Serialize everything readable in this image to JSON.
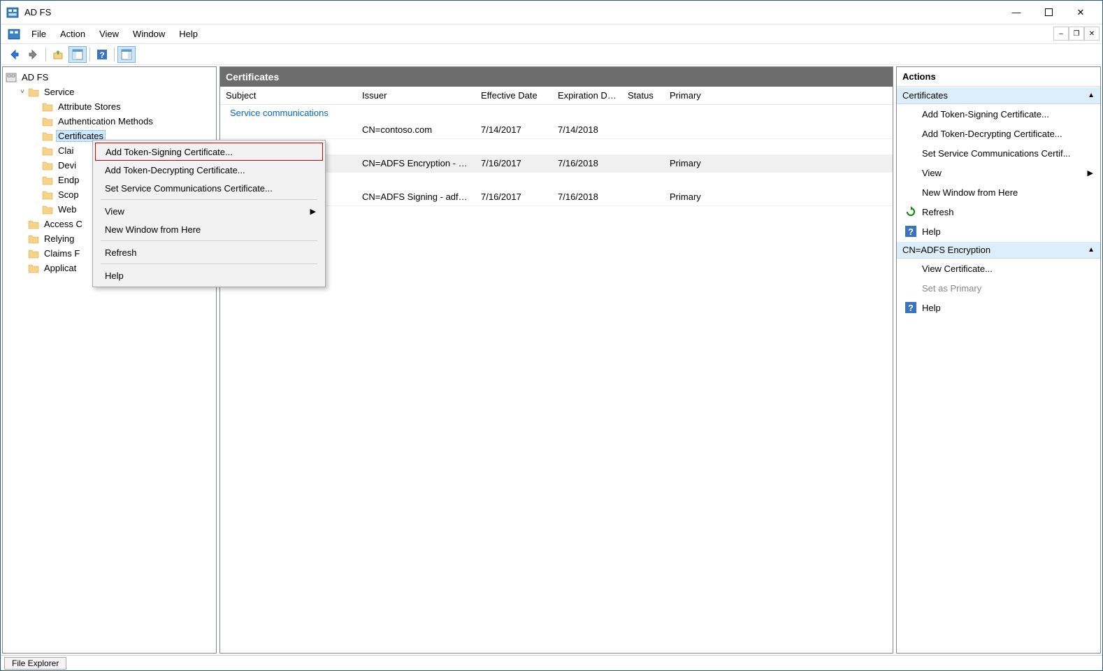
{
  "title": "AD FS",
  "menubar": [
    "File",
    "Action",
    "View",
    "Window",
    "Help"
  ],
  "tree": {
    "root": "AD FS",
    "nodes": [
      {
        "label": "Service",
        "indent": 1,
        "expandable": true,
        "expanded": true
      },
      {
        "label": "Attribute Stores",
        "indent": 2
      },
      {
        "label": "Authentication Methods",
        "indent": 2
      },
      {
        "label": "Certificates",
        "indent": 2,
        "selected": true
      },
      {
        "label": "Clai",
        "indent": 2
      },
      {
        "label": "Devi",
        "indent": 2
      },
      {
        "label": "Endp",
        "indent": 2
      },
      {
        "label": "Scop",
        "indent": 2
      },
      {
        "label": "Web",
        "indent": 2
      },
      {
        "label": "Access C",
        "indent": 1
      },
      {
        "label": "Relying",
        "indent": 1
      },
      {
        "label": "Claims F",
        "indent": 1
      },
      {
        "label": "Applicat",
        "indent": 1
      }
    ]
  },
  "list": {
    "title": "Certificates",
    "columns": {
      "subject": "Subject",
      "issuer": "Issuer",
      "eff": "Effective Date",
      "exp": "Expiration Date",
      "status": "Status",
      "primary": "Primary"
    },
    "group1": "Service communications",
    "rows": [
      {
        "subject": "",
        "issuer": "CN=contoso.com",
        "eff": "7/14/2017",
        "exp": "7/14/2018",
        "status": "",
        "primary": ""
      },
      {
        "subject": "",
        "issuer": "CN=ADFS Encryption - ad...",
        "eff": "7/16/2017",
        "exp": "7/16/2018",
        "status": "",
        "primary": "Primary",
        "selected": true
      },
      {
        "subject": "",
        "issuer": "CN=ADFS Signing - adfs....",
        "eff": "7/16/2017",
        "exp": "7/16/2018",
        "status": "",
        "primary": "Primary"
      }
    ]
  },
  "actions": {
    "title": "Actions",
    "section1": "Certificates",
    "items1": [
      "Add Token-Signing Certificate...",
      "Add Token-Decrypting Certificate...",
      "Set Service Communications Certif..."
    ],
    "view": "View",
    "newwin": "New Window from Here",
    "refresh": "Refresh",
    "help1": "Help",
    "section2": "CN=ADFS Encryption",
    "viewcert": "View Certificate...",
    "setprimary": "Set as Primary",
    "help2": "Help"
  },
  "context_menu": {
    "items": [
      {
        "label": "Add Token-Signing Certificate...",
        "hl": true
      },
      {
        "label": "Add Token-Decrypting Certificate..."
      },
      {
        "label": "Set Service Communications Certificate..."
      },
      {
        "sep": true
      },
      {
        "label": "View",
        "submenu": true
      },
      {
        "label": "New Window from Here"
      },
      {
        "sep": true
      },
      {
        "label": "Refresh"
      },
      {
        "sep": true
      },
      {
        "label": "Help"
      }
    ]
  },
  "taskbar": "File Explorer"
}
